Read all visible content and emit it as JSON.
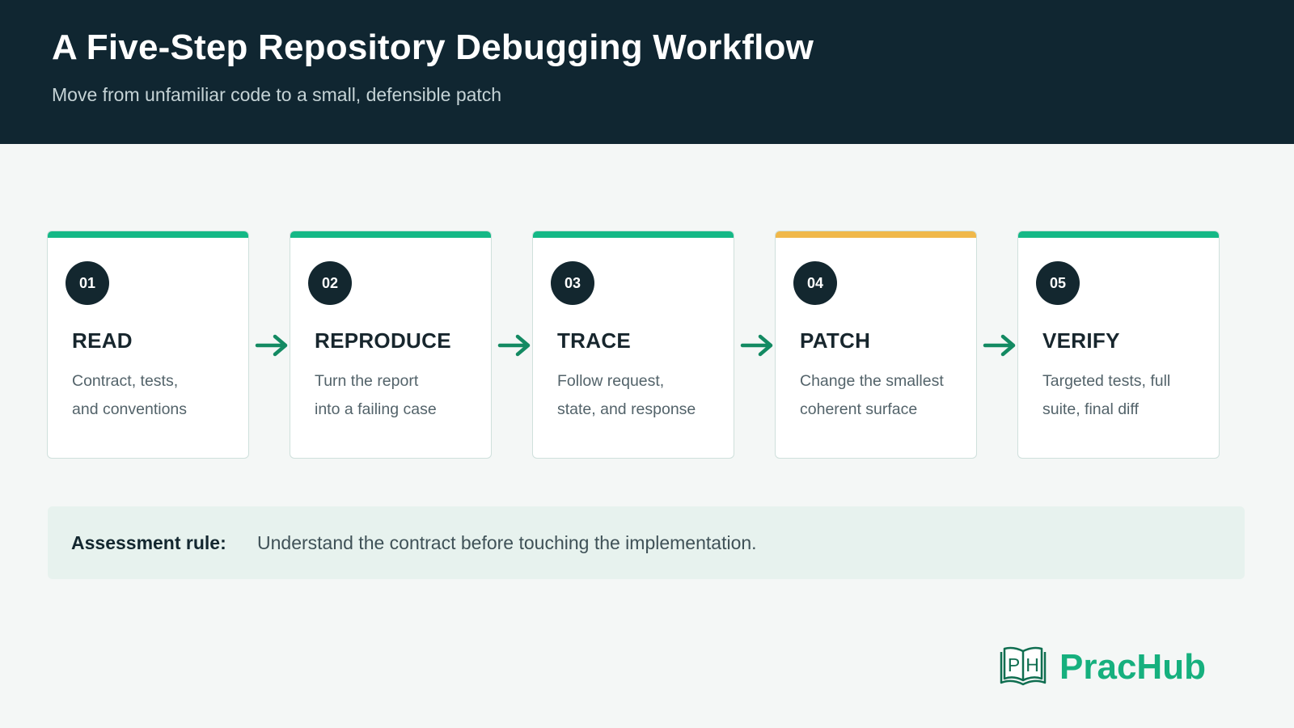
{
  "header": {
    "title": "A Five-Step Repository Debugging Workflow",
    "subtitle": "Move from unfamiliar code to a small, defensible patch"
  },
  "steps": [
    {
      "number": "01",
      "name": "READ",
      "description": "Contract, tests,\nand conventions",
      "accent": "#14b886"
    },
    {
      "number": "02",
      "name": "REPRODUCE",
      "description": "Turn the report\ninto a failing case",
      "accent": "#14b886"
    },
    {
      "number": "03",
      "name": "TRACE",
      "description": "Follow request,\nstate, and response",
      "accent": "#14b886"
    },
    {
      "number": "04",
      "name": "PATCH",
      "description": "Change the smallest\ncoherent surface",
      "accent": "#f0b84a"
    },
    {
      "number": "05",
      "name": "VERIFY",
      "description": "Targeted tests, full\nsuite, final diff",
      "accent": "#14b886"
    }
  ],
  "assessment": {
    "label": "Assessment rule:",
    "text": "Understand the contract before touching the implementation."
  },
  "brand": {
    "name": "PracHub",
    "logo_letters": "PH",
    "color": "#16b07e"
  },
  "colors": {
    "header_bg": "#102631",
    "arrow": "#138a62",
    "badge_bg": "#13272f"
  }
}
